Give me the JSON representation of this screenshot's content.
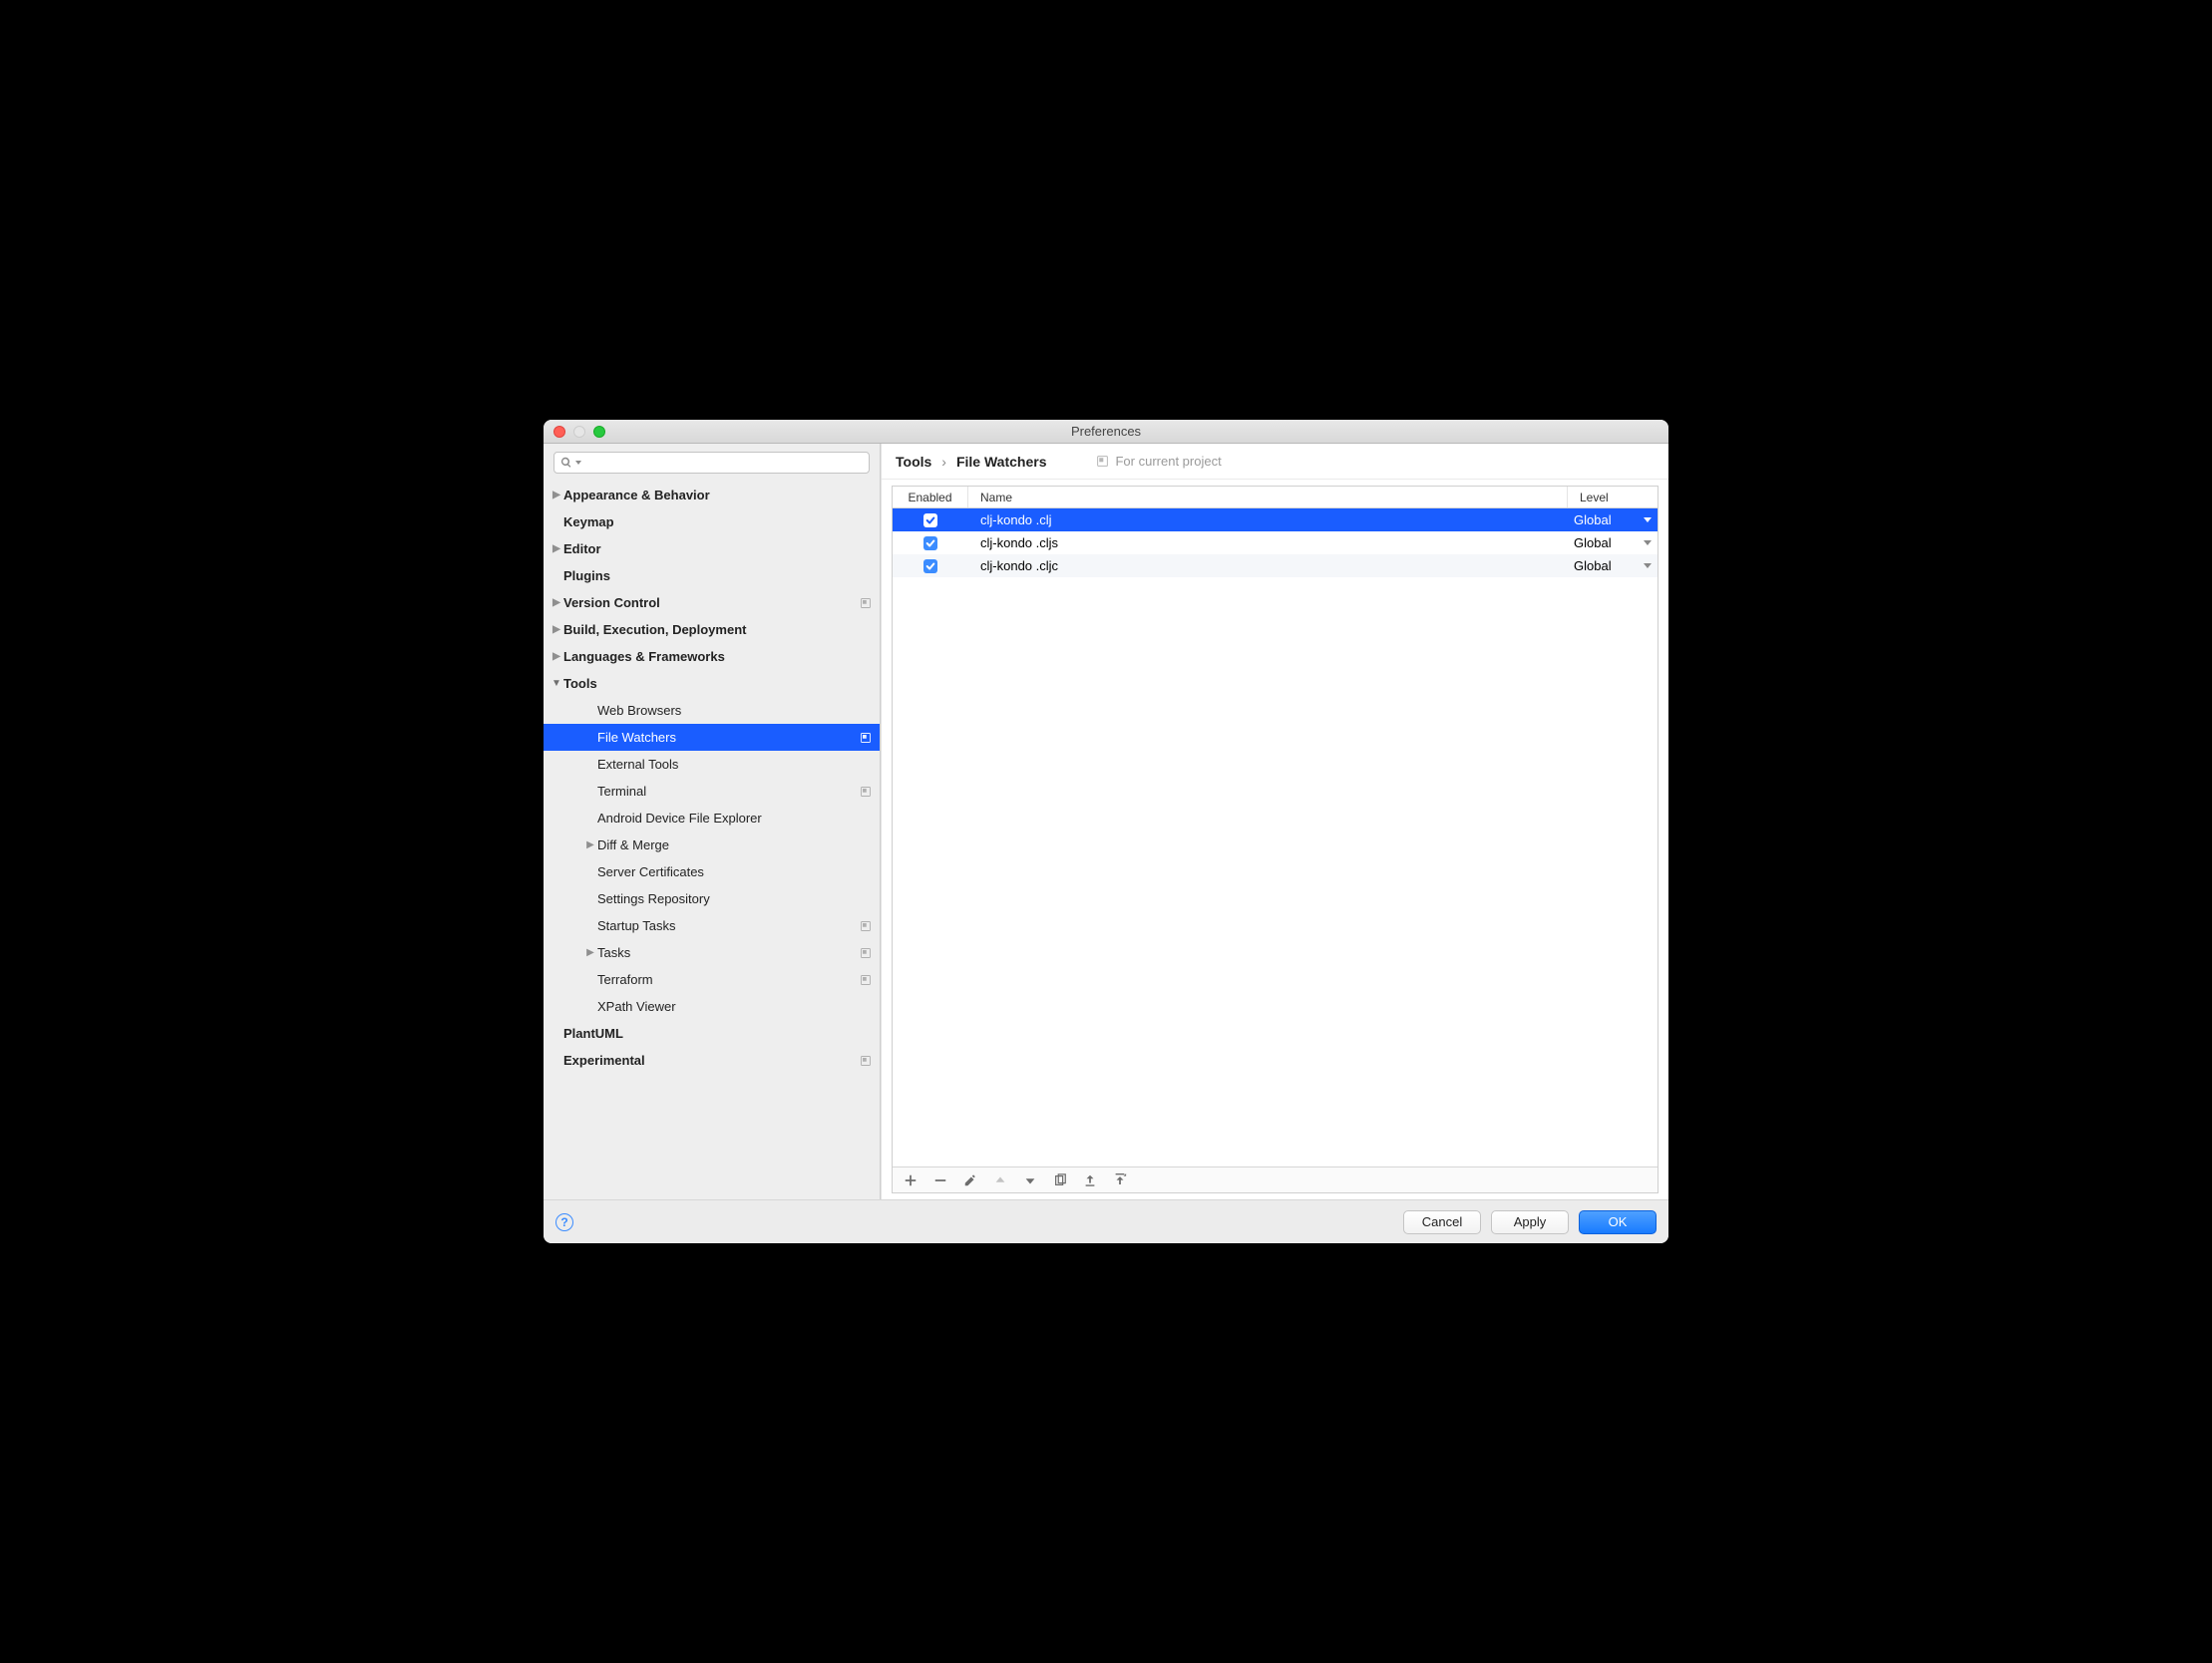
{
  "window": {
    "title": "Preferences"
  },
  "search": {
    "placeholder": ""
  },
  "sidebar": [
    {
      "label": "Appearance & Behavior",
      "type": "group",
      "expanded": false,
      "arrow": true
    },
    {
      "label": "Keymap",
      "type": "item"
    },
    {
      "label": "Editor",
      "type": "group",
      "expanded": false,
      "arrow": true
    },
    {
      "label": "Plugins",
      "type": "item"
    },
    {
      "label": "Version Control",
      "type": "group",
      "expanded": false,
      "arrow": true,
      "proj": true
    },
    {
      "label": "Build, Execution, Deployment",
      "type": "group",
      "expanded": false,
      "arrow": true
    },
    {
      "label": "Languages & Frameworks",
      "type": "group",
      "expanded": false,
      "arrow": true
    },
    {
      "label": "Tools",
      "type": "group",
      "expanded": true,
      "arrow": true,
      "children": [
        {
          "label": "Web Browsers"
        },
        {
          "label": "File Watchers",
          "selected": true,
          "proj": true
        },
        {
          "label": "External Tools"
        },
        {
          "label": "Terminal",
          "proj": true
        },
        {
          "label": "Android Device File Explorer"
        },
        {
          "label": "Diff & Merge",
          "arrow": true
        },
        {
          "label": "Server Certificates"
        },
        {
          "label": "Settings Repository"
        },
        {
          "label": "Startup Tasks",
          "proj": true
        },
        {
          "label": "Tasks",
          "arrow": true,
          "proj": true
        },
        {
          "label": "Terraform",
          "proj": true
        },
        {
          "label": "XPath Viewer"
        }
      ]
    },
    {
      "label": "PlantUML",
      "type": "item"
    },
    {
      "label": "Experimental",
      "type": "item",
      "proj": true
    }
  ],
  "breadcrumb": {
    "root": "Tools",
    "leaf": "File Watchers",
    "scope": "For current project"
  },
  "table": {
    "headers": {
      "enabled": "Enabled",
      "name": "Name",
      "level": "Level"
    },
    "rows": [
      {
        "enabled": true,
        "name": "clj-kondo .clj",
        "level": "Global",
        "selected": true
      },
      {
        "enabled": true,
        "name": "clj-kondo .cljs",
        "level": "Global"
      },
      {
        "enabled": true,
        "name": "clj-kondo .cljc",
        "level": "Global",
        "alt": true
      }
    ]
  },
  "buttons": {
    "cancel": "Cancel",
    "apply": "Apply",
    "ok": "OK"
  }
}
